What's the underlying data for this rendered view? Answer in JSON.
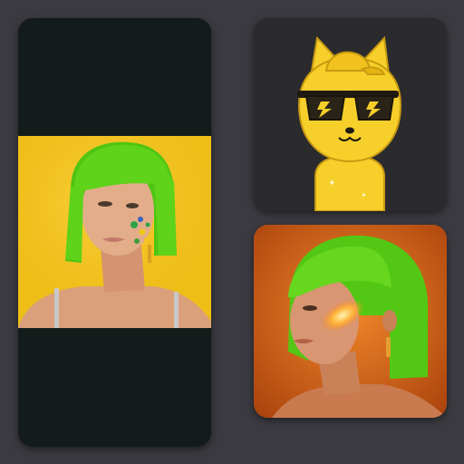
{
  "gallery": {
    "cards": [
      {
        "subject": "portrait-green-bob-yellow-background"
      },
      {
        "subject": "yellow-cat-mascot-with-cap-and-sunglasses"
      },
      {
        "subject": "portrait-green-bob-orange-glow"
      }
    ]
  },
  "colors": {
    "page_background": "#3a3a40",
    "left_card_background": "#131c1a",
    "yellow_backdrop": "#f1c31a",
    "mascot_card_background": "#2b2b2e",
    "mascot_yellow": "#f6cf2a",
    "orange_backdrop": "#d96418",
    "hair_green": "#5fd21a"
  }
}
